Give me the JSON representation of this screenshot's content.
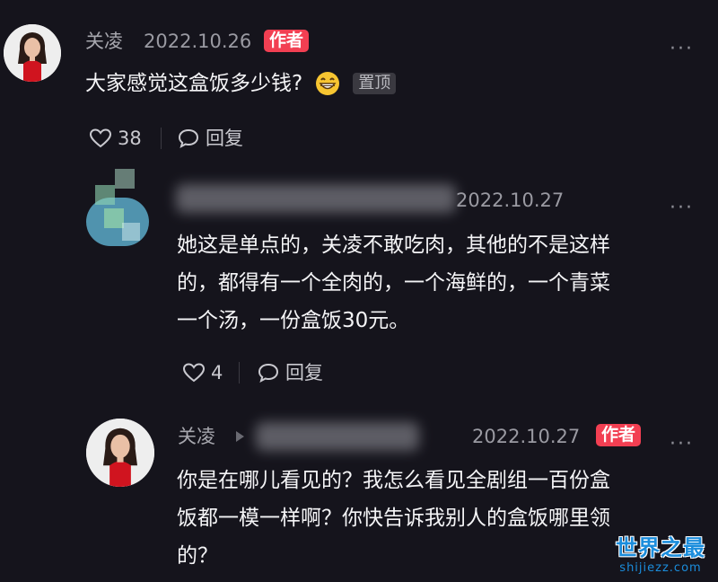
{
  "comment1": {
    "author": "关凌",
    "date": "2022.10.26",
    "badge": "作者",
    "text": "大家感觉这盒饭多少钱?",
    "emoji": "😁",
    "pin_label": "置顶",
    "likes": "38",
    "reply_label": "回复",
    "more": "···"
  },
  "reply1": {
    "date": "2022.10.27",
    "line1": "她这是单点的，关凌不敢吃肉，其他的不是这样",
    "line2": "的，都得有一个全肉的，一个海鲜的，一个青菜",
    "line3": "一个汤，一份盒饭30元。",
    "likes": "4",
    "reply_label": "回复",
    "more": "···"
  },
  "reply2": {
    "author": "关凌",
    "date": "2022.10.27",
    "badge": "作者",
    "line1": "你是在哪儿看见的？我怎么看见全剧组一百份盒",
    "line2": "饭都一模一样啊？你快告诉我别人的盒饭哪里领",
    "line3": "的？",
    "more": "···"
  },
  "watermark": {
    "main": "世界之最",
    "sub": "shijiezz.com"
  }
}
